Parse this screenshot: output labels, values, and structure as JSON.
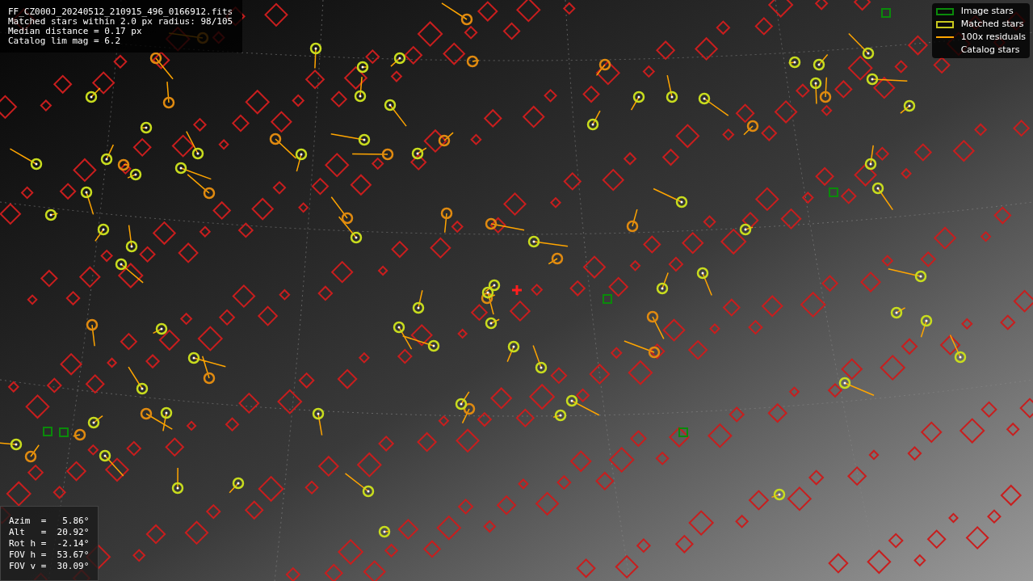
{
  "header": {
    "lines": [
      "FF_CZ000J_20240512_210915_496_0166912.fits",
      "Matched stars within 2.0 px radius: 98/105",
      "Median distance = 0.17 px",
      "Catalog lim mag = 6.2"
    ]
  },
  "legend": {
    "items": [
      {
        "label": "Image stars",
        "kind": "rect",
        "color": "#0a8a0a"
      },
      {
        "label": "Matched stars",
        "kind": "rect",
        "color": "#c8c81e"
      },
      {
        "label": "100x residuals",
        "kind": "line",
        "color": "#ffa500"
      },
      {
        "label": "Catalog stars",
        "kind": "none"
      }
    ]
  },
  "orientation": {
    "lines": [
      "Azim  =   5.86°",
      "Alt   =  20.92°",
      "Rot h =  -2.14°",
      "FOV h =  53.67°",
      "FOV v =  30.09°"
    ]
  }
}
